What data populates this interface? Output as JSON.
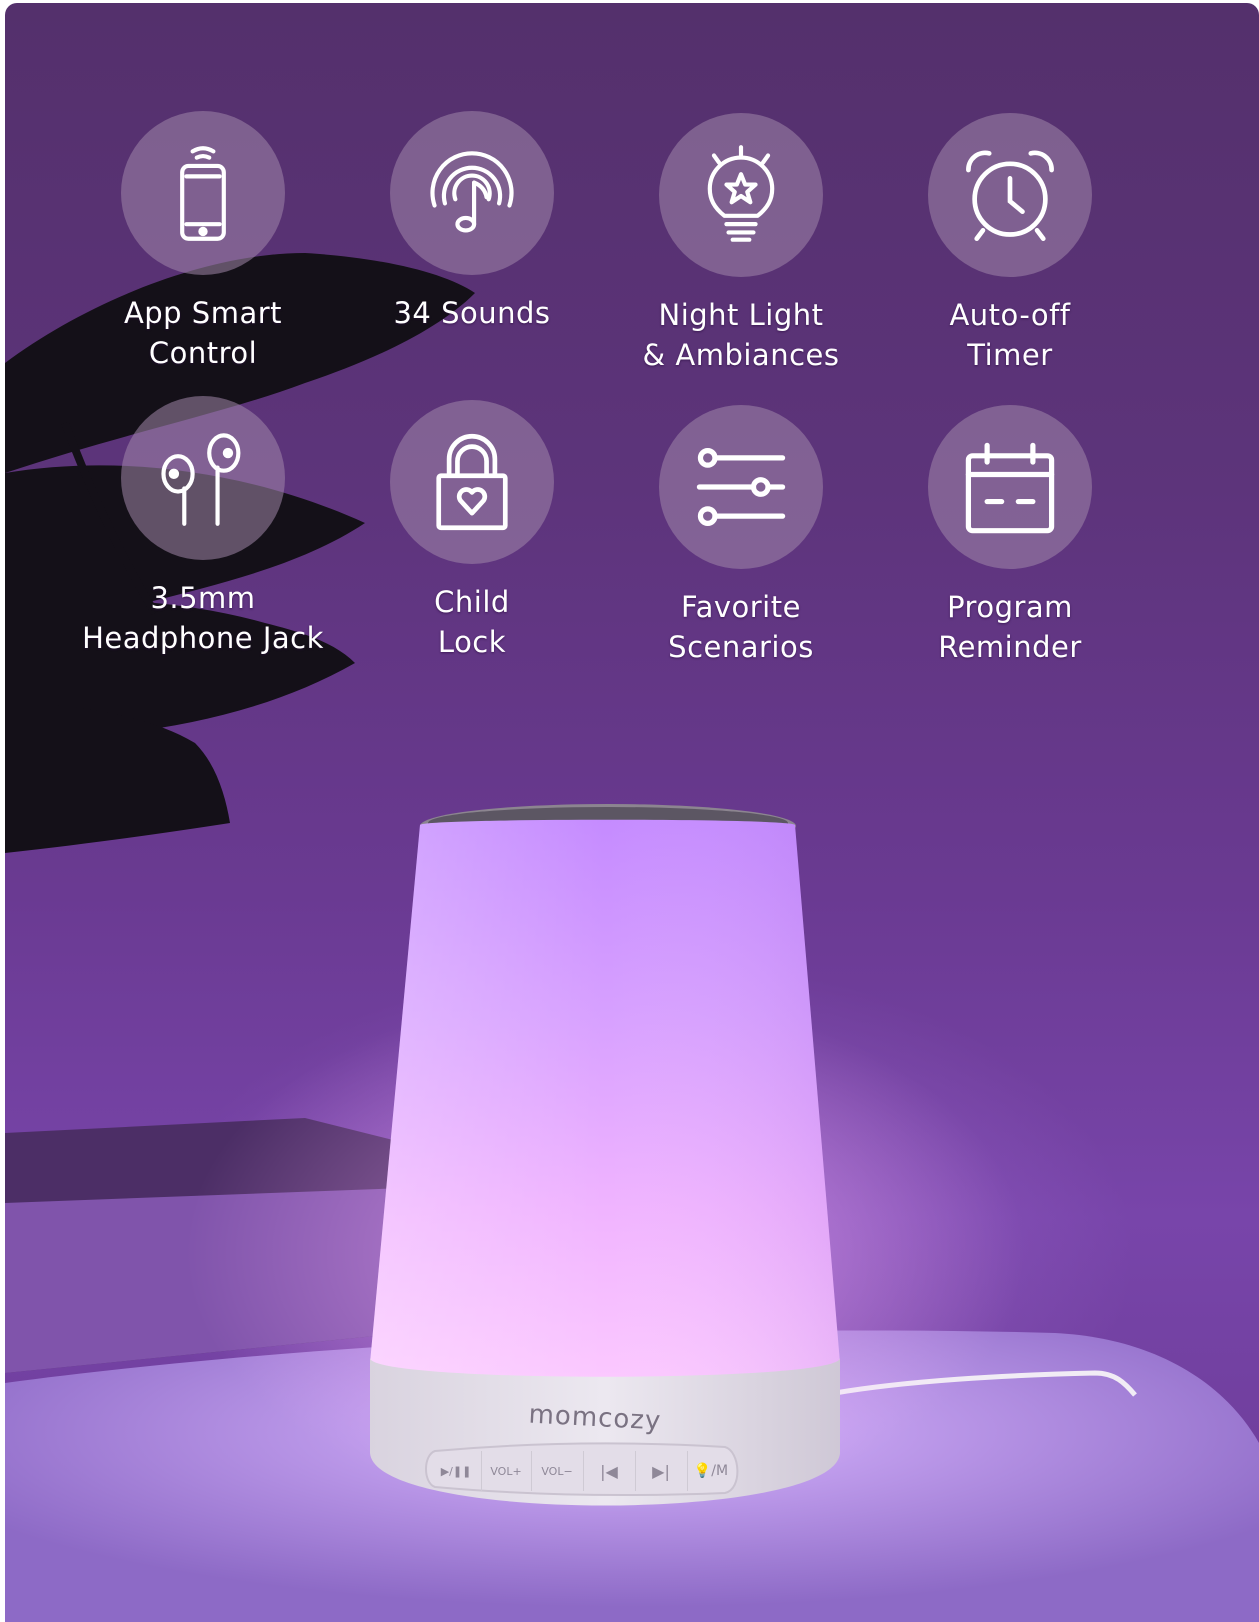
{
  "features": [
    {
      "icon": "smartphone-wifi-icon",
      "lines": [
        "App Smart",
        "Control"
      ]
    },
    {
      "icon": "music-note-icon",
      "lines": [
        "34 Sounds"
      ]
    },
    {
      "icon": "light-bulb-star-icon",
      "lines": [
        "Night Light",
        "& Ambiances"
      ]
    },
    {
      "icon": "alarm-clock-icon",
      "lines": [
        "Auto-off",
        "Timer"
      ]
    },
    {
      "icon": "earphones-icon",
      "lines": [
        "3.5mm",
        "Headphone Jack"
      ]
    },
    {
      "icon": "padlock-heart-icon",
      "lines": [
        "Child",
        "Lock"
      ]
    },
    {
      "icon": "sliders-icon",
      "lines": [
        "Favorite",
        "Scenarios"
      ]
    },
    {
      "icon": "calendar-icon",
      "lines": [
        "Program",
        "Reminder"
      ]
    }
  ],
  "product": {
    "brand": "momcozy",
    "buttons": [
      "▶/❚❚",
      "VOL+",
      "VOL−",
      "|◀",
      "▶|",
      "💡/M"
    ]
  },
  "colors": {
    "background": "#5d347b",
    "glow": "#e6a8ff",
    "circle": "#a087aa",
    "text": "#ffffff"
  }
}
